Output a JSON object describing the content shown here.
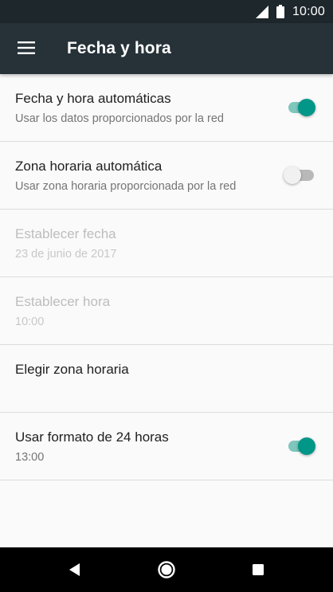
{
  "status_bar": {
    "time": "10:00",
    "icons": [
      "signal-icon",
      "battery-icon"
    ]
  },
  "app_bar": {
    "title": "Fecha y hora",
    "menu_icon": "hamburger-menu-icon"
  },
  "colors": {
    "accent": "#009688",
    "app_bar": "#263238",
    "status_bar": "#1e272c"
  },
  "settings": [
    {
      "title": "Fecha y hora automáticas",
      "summary": "Usar los datos proporcionados por la red",
      "switch": true,
      "enabled": true
    },
    {
      "title": "Zona horaria automática",
      "summary": "Usar zona horaria proporcionada por la red",
      "switch": false,
      "enabled": true
    },
    {
      "title": "Establecer fecha",
      "summary": "23 de junio de 2017",
      "enabled": false
    },
    {
      "title": "Establecer hora",
      "summary": "10:00",
      "enabled": false
    },
    {
      "title": "Elegir zona horaria",
      "summary": "",
      "enabled": true
    },
    {
      "title": "Usar formato de 24 horas",
      "summary": "13:00",
      "switch": true,
      "enabled": true
    }
  ],
  "nav_bar": {
    "icons": [
      "back-icon",
      "home-icon",
      "recents-icon"
    ]
  }
}
